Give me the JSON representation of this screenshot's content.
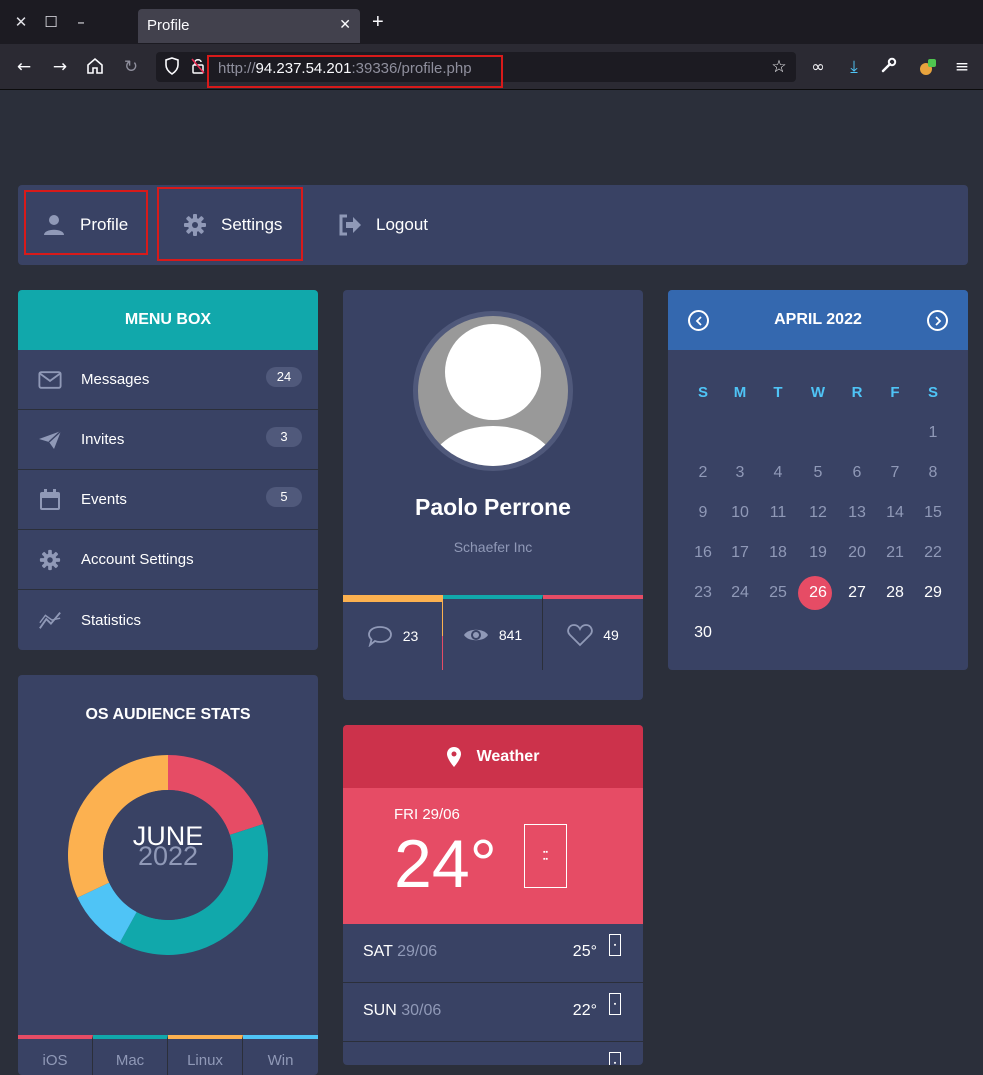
{
  "browser": {
    "tab_title": "Profile",
    "url_prefix": "http://",
    "url_host": "94.237.54.201",
    "url_rest": ":39336/profile.php"
  },
  "topnav": {
    "profile": "Profile",
    "settings": "Settings",
    "logout": "Logout"
  },
  "menu_box": {
    "title": "MENU BOX",
    "items": [
      {
        "label": "Messages",
        "badge": "24",
        "icon": "envelope-icon"
      },
      {
        "label": "Invites",
        "badge": "3",
        "icon": "paper-plane-icon"
      },
      {
        "label": "Events",
        "badge": "5",
        "icon": "calendar-icon"
      },
      {
        "label": "Account Settings",
        "icon": "gear-icon"
      },
      {
        "label": "Statistics",
        "icon": "chart-line-icon"
      }
    ]
  },
  "os_stats": {
    "title": "OS AUDIENCE STATS",
    "month": "JUNE",
    "year": "2022",
    "legend": [
      "iOS",
      "Mac",
      "Linux",
      "Win"
    ],
    "colors": {
      "ios": "#e64c65",
      "mac": "#11a8ab",
      "linux": "#fcb150",
      "win": "#4fc4f6"
    }
  },
  "chart_data": {
    "type": "pie",
    "categories": [
      "iOS",
      "Mac",
      "Linux",
      "Win"
    ],
    "values": [
      20,
      38,
      32,
      10
    ]
  },
  "profile": {
    "name": "Paolo Perrone",
    "company": "Schaefer Inc",
    "comments": "23",
    "views": "841",
    "likes": "49"
  },
  "weather": {
    "title": "Weather",
    "today_label": "FRI 29/06",
    "today_temp": "24°",
    "rows": [
      {
        "day": "SAT",
        "date": "29/06",
        "temp": "25°"
      },
      {
        "day": "SUN",
        "date": "30/06",
        "temp": "22°"
      }
    ]
  },
  "calendar": {
    "title": "APRIL 2022",
    "weekdays": [
      "S",
      "M",
      "T",
      "W",
      "R",
      "F",
      "S"
    ],
    "today": "26",
    "rows": [
      [
        "",
        "",
        "",
        "",
        "",
        "",
        "1"
      ],
      [
        "2",
        "3",
        "4",
        "5",
        "6",
        "7",
        "8"
      ],
      [
        "9",
        "10",
        "11",
        "12",
        "13",
        "14",
        "15"
      ],
      [
        "16",
        "17",
        "18",
        "19",
        "20",
        "21",
        "22"
      ],
      [
        "23",
        "24",
        "25",
        "26",
        "27",
        "28",
        "29"
      ],
      [
        "30",
        "",
        "",
        "",
        "",
        "",
        ""
      ]
    ]
  }
}
